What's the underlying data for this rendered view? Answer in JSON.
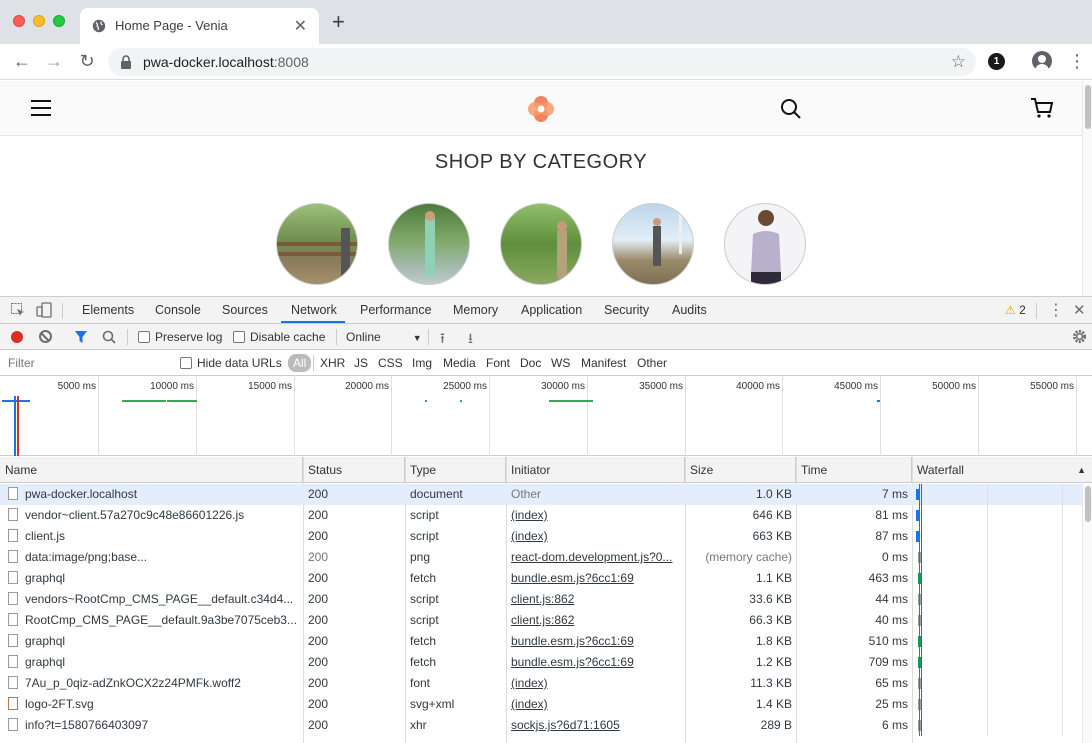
{
  "browser": {
    "tab_title": "Home Page - Venia",
    "url_host": "pwa-docker.localhost",
    "url_port": ":8008",
    "extension_badge": "1"
  },
  "page": {
    "shop_title": "SHOP BY CATEGORY",
    "brand_color": "#f16c45"
  },
  "devtools": {
    "tabs": [
      "Elements",
      "Console",
      "Sources",
      "Network",
      "Performance",
      "Memory",
      "Application",
      "Security",
      "Audits"
    ],
    "active_tab": "Network",
    "warnings": "2",
    "preserve_log": "Preserve log",
    "disable_cache": "Disable cache",
    "throttling": "Online",
    "filter_placeholder": "Filter",
    "hide_data_urls": "Hide data URLs",
    "filter_types": [
      "All",
      "XHR",
      "JS",
      "CSS",
      "Img",
      "Media",
      "Font",
      "Doc",
      "WS",
      "Manifest",
      "Other"
    ],
    "overview_ticks": [
      "5000 ms",
      "10000 ms",
      "15000 ms",
      "20000 ms",
      "25000 ms",
      "30000 ms",
      "35000 ms",
      "40000 ms",
      "45000 ms",
      "50000 ms",
      "55000 ms"
    ],
    "columns": {
      "name": "Name",
      "status": "Status",
      "type": "Type",
      "initiator": "Initiator",
      "size": "Size",
      "time": "Time",
      "waterfall": "Waterfall"
    },
    "requests": [
      {
        "name": "pwa-docker.localhost",
        "status": "200",
        "type": "document",
        "initiator": "Other",
        "size": "1.0 KB",
        "time": "7 ms"
      },
      {
        "name": "vendor~client.57a270c9c48e86601226.js",
        "status": "200",
        "type": "script",
        "initiator": "(index)",
        "size": "646 KB",
        "time": "81 ms"
      },
      {
        "name": "client.js",
        "status": "200",
        "type": "script",
        "initiator": "(index)",
        "size": "663 KB",
        "time": "87 ms"
      },
      {
        "name": "data:image/png;base...",
        "status": "200",
        "type": "png",
        "initiator": "react-dom.development.js?0...",
        "size": "(memory cache)",
        "time": "0 ms"
      },
      {
        "name": "graphql",
        "status": "200",
        "type": "fetch",
        "initiator": "bundle.esm.js?6cc1:69",
        "size": "1.1 KB",
        "time": "463 ms"
      },
      {
        "name": "vendors~RootCmp_CMS_PAGE__default.c34d4...",
        "status": "200",
        "type": "script",
        "initiator": "client.js:862",
        "size": "33.6 KB",
        "time": "44 ms"
      },
      {
        "name": "RootCmp_CMS_PAGE__default.9a3be7075ceb3...",
        "status": "200",
        "type": "script",
        "initiator": "client.js:862",
        "size": "66.3 KB",
        "time": "40 ms"
      },
      {
        "name": "graphql",
        "status": "200",
        "type": "fetch",
        "initiator": "bundle.esm.js?6cc1:69",
        "size": "1.8 KB",
        "time": "510 ms"
      },
      {
        "name": "graphql",
        "status": "200",
        "type": "fetch",
        "initiator": "bundle.esm.js?6cc1:69",
        "size": "1.2 KB",
        "time": "709 ms"
      },
      {
        "name": "7Au_p_0qiz-adZnkOCX2z24PMFk.woff2",
        "status": "200",
        "type": "font",
        "initiator": "(index)",
        "size": "11.3 KB",
        "time": "65 ms"
      },
      {
        "name": "logo-2FT.svg",
        "status": "200",
        "type": "svg+xml",
        "initiator": "(index)",
        "size": "1.4 KB",
        "time": "25 ms"
      },
      {
        "name": "info?t=1580766403097",
        "status": "200",
        "type": "xhr",
        "initiator": "sockjs.js?6d71:1605",
        "size": "289 B",
        "time": "6 ms"
      }
    ]
  }
}
